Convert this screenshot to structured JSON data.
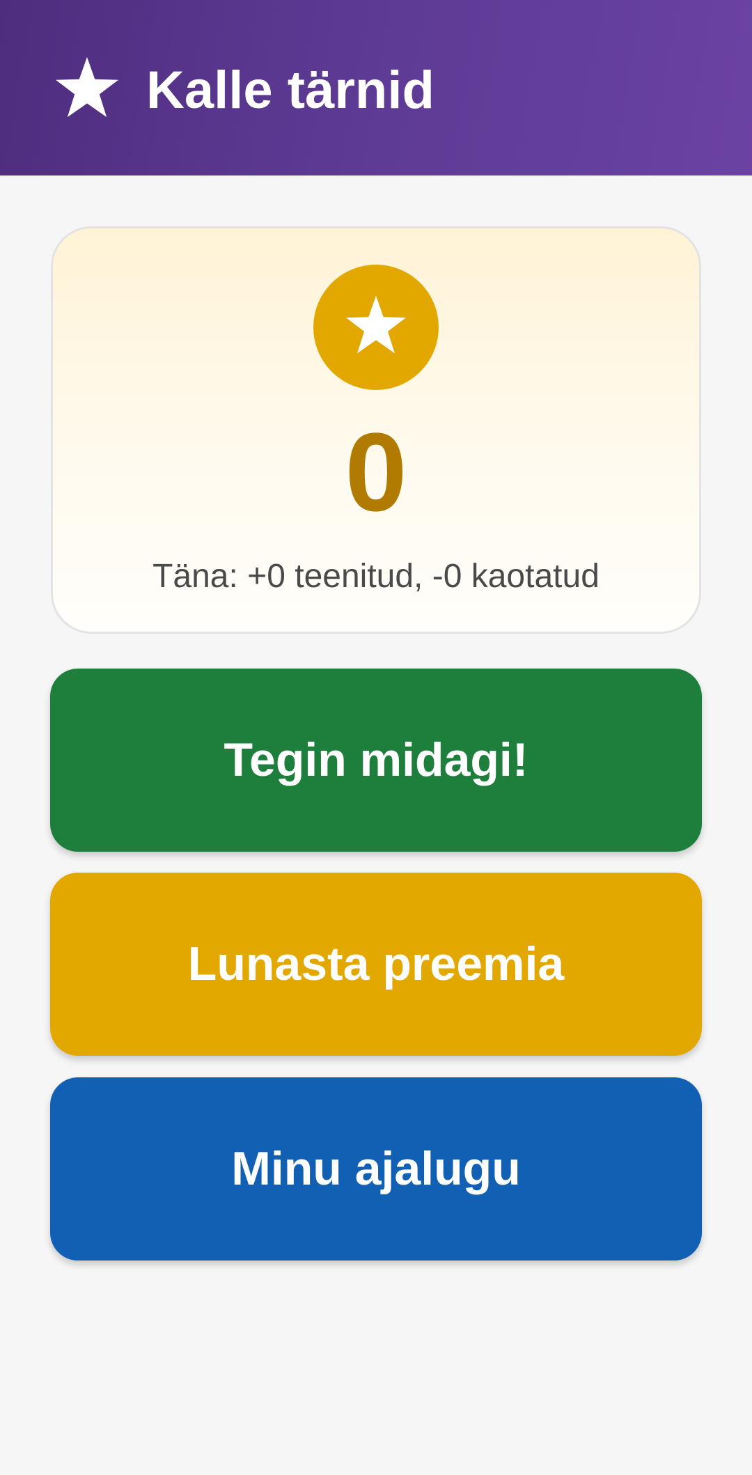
{
  "app_bar": {
    "icon": "star-icon",
    "title": "Kalle tärnid",
    "gradient_colors": [
      "#4e2d7e",
      "#6b42a3"
    ]
  },
  "score_card": {
    "icon": "star-icon",
    "coin_color": "#e3a800",
    "stars": "0",
    "today_summary": "Täna: +0 teenitud, -0 kaotatud"
  },
  "actions": [
    {
      "label": "Tegin midagi!",
      "color": "#1e7f3c"
    },
    {
      "label": "Lunasta preemia",
      "color": "#e3a800"
    },
    {
      "label": "Minu ajalugu",
      "color": "#1160b4"
    }
  ]
}
